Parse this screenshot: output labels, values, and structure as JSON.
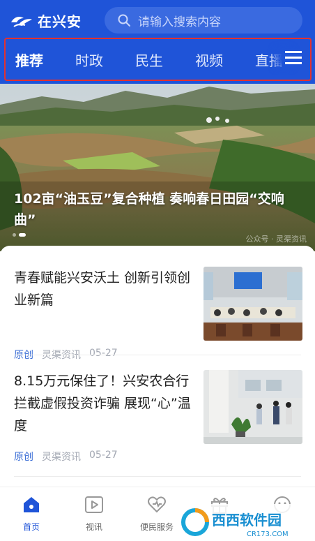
{
  "header": {
    "brand": "在兴安",
    "search_placeholder": "请输入搜索内容",
    "tabs": [
      "推荐",
      "时政",
      "民生",
      "视频",
      "直播"
    ]
  },
  "hero": {
    "title": "102亩“油玉豆”复合种植 奏响春日田园“交响曲”",
    "watermark": "公众号 · 灵渠资讯"
  },
  "feed": [
    {
      "title": "青春赋能兴安沃土 创新引领创业新篇",
      "tag": "原创",
      "source": "灵渠资讯",
      "date": "05-27"
    },
    {
      "title": "8.15万元保住了！兴安农合行拦截虚假投资诈骗 展现“心”温度",
      "tag": "原创",
      "source": "灵渠资讯",
      "date": "05-27"
    }
  ],
  "bottom_nav": [
    {
      "label": "首页",
      "icon": "home-icon"
    },
    {
      "label": "视讯",
      "icon": "video-icon"
    },
    {
      "label": "便民服务",
      "icon": "heart-icon"
    },
    {
      "label": "",
      "icon": "gift-icon"
    },
    {
      "label": "",
      "icon": "face-icon"
    }
  ],
  "overlay": {
    "brand": "西西软件园",
    "url": "CR173.COM"
  },
  "colors": {
    "primary": "#1f54d8",
    "highlight": "#e3312f",
    "tag": "#3d6fd6"
  }
}
